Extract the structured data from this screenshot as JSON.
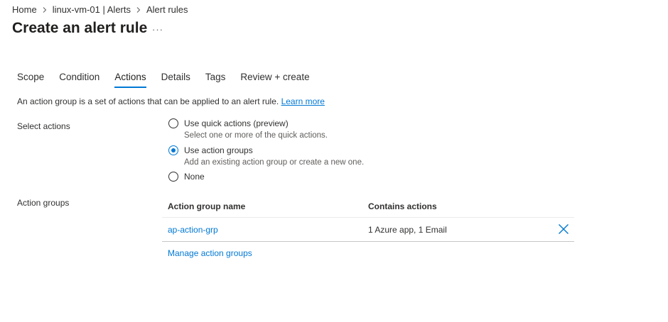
{
  "breadcrumb": {
    "items": [
      "Home",
      "linux-vm-01 | Alerts",
      "Alert rules"
    ]
  },
  "page": {
    "title": "Create an alert rule",
    "more": "···"
  },
  "tabs": [
    {
      "label": "Scope",
      "active": false
    },
    {
      "label": "Condition",
      "active": false
    },
    {
      "label": "Actions",
      "active": true
    },
    {
      "label": "Details",
      "active": false
    },
    {
      "label": "Tags",
      "active": false
    },
    {
      "label": "Review + create",
      "active": false
    }
  ],
  "intro": {
    "text": "An action group is a set of actions that can be applied to an alert rule.",
    "link": "Learn more"
  },
  "select_actions": {
    "label": "Select actions",
    "options": [
      {
        "title": "Use quick actions (preview)",
        "desc": "Select one or more of the quick actions.",
        "checked": false
      },
      {
        "title": "Use action groups",
        "desc": "Add an existing action group or create a new one.",
        "checked": true
      },
      {
        "title": "None",
        "desc": "",
        "checked": false
      }
    ]
  },
  "action_groups": {
    "label": "Action groups",
    "columns": [
      "Action group name",
      "Contains actions"
    ],
    "rows": [
      {
        "name": "ap-action-grp",
        "actions": "1 Azure app, 1 Email"
      }
    ],
    "manage_link": "Manage action groups"
  },
  "colors": {
    "accent": "#0078d4",
    "text": "#323130",
    "secondary_text": "#605e5c"
  },
  "icons": {
    "breadcrumb_separator": "chevron-right-icon",
    "delete": "close-icon"
  }
}
